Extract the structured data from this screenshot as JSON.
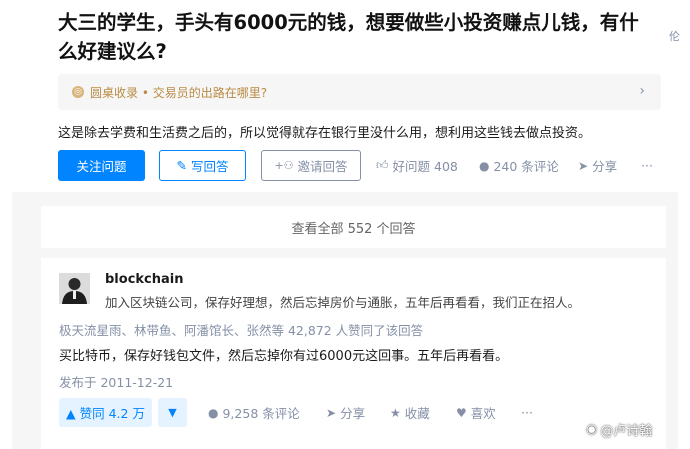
{
  "question": {
    "title": "大三的学生，手头有6000元的钱，想要做些小投资赚点儿钱，有什么好建议么?",
    "side_glyph": "伦",
    "roundtable_label": "圆桌收录 • 交易员的出路在哪里?",
    "description": "这是除去学费和生活费之后的，所以觉得就存在银行里没什么用，想利用这些钱去做点投资。",
    "follow_label": "关注问题",
    "write_label": "写回答",
    "invite_label": "邀请回答",
    "good_question_label": "好问题 408",
    "comments_label": "240 条评论",
    "share_label": "分享",
    "more_label": "···"
  },
  "view_all_label": "查看全部 552 个回答",
  "answer": {
    "author_name": "blockchain",
    "author_bio": "加入区块链公司，保存好理想，然后忘掉房价与通胀，五年后再看看，我们正在招人。",
    "voters_text": "极天流星雨、林带鱼、阿潘馆长、张然等 42,872 人赞同了该回答",
    "content": "买比特币，保存好钱包文件，然后忘掉你有过6000元这回事。五年后再看看。",
    "date": "发布于 2011-12-21",
    "upvote_label": "▲ 赞同 4.2 万",
    "downvote_label": "▼",
    "comments_label": "9,258 条评论",
    "share_label": "分享",
    "favorite_label": "收藏",
    "like_label": "喜欢",
    "more_label": "···"
  },
  "watermark": "@卢诗翰"
}
